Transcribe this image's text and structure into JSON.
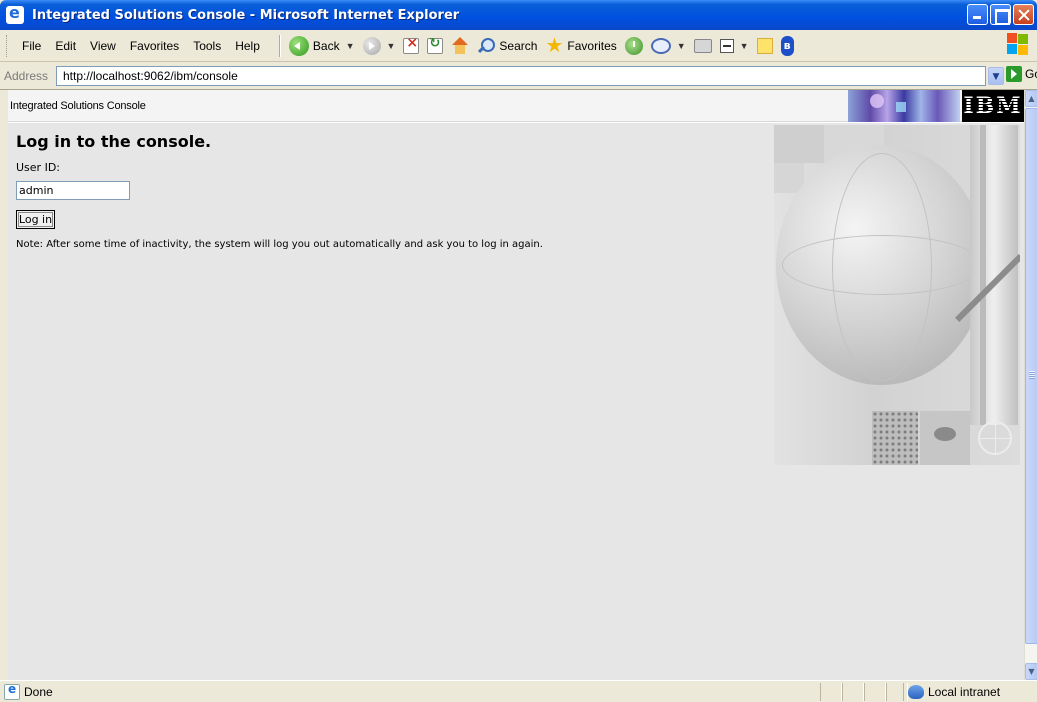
{
  "window": {
    "title": "Integrated Solutions Console - Microsoft Internet Explorer"
  },
  "menu": {
    "items": [
      "File",
      "Edit",
      "View",
      "Favorites",
      "Tools",
      "Help"
    ]
  },
  "toolbar": {
    "back_label": "Back",
    "search_label": "Search",
    "favorites_label": "Favorites"
  },
  "address": {
    "label": "Address",
    "url": "http://localhost:9062/ibm/console",
    "go_label": "Go"
  },
  "console": {
    "header_title": "Integrated Solutions Console",
    "logo_text": "IBM"
  },
  "login": {
    "heading": "Log in to the console.",
    "user_id_label": "User ID:",
    "user_id_value": "admin",
    "button_label": "Log in",
    "note": "Note: After some time of inactivity, the system will log you out automatically and ask you to log in again."
  },
  "status": {
    "text": "Done",
    "zone": "Local intranet"
  }
}
